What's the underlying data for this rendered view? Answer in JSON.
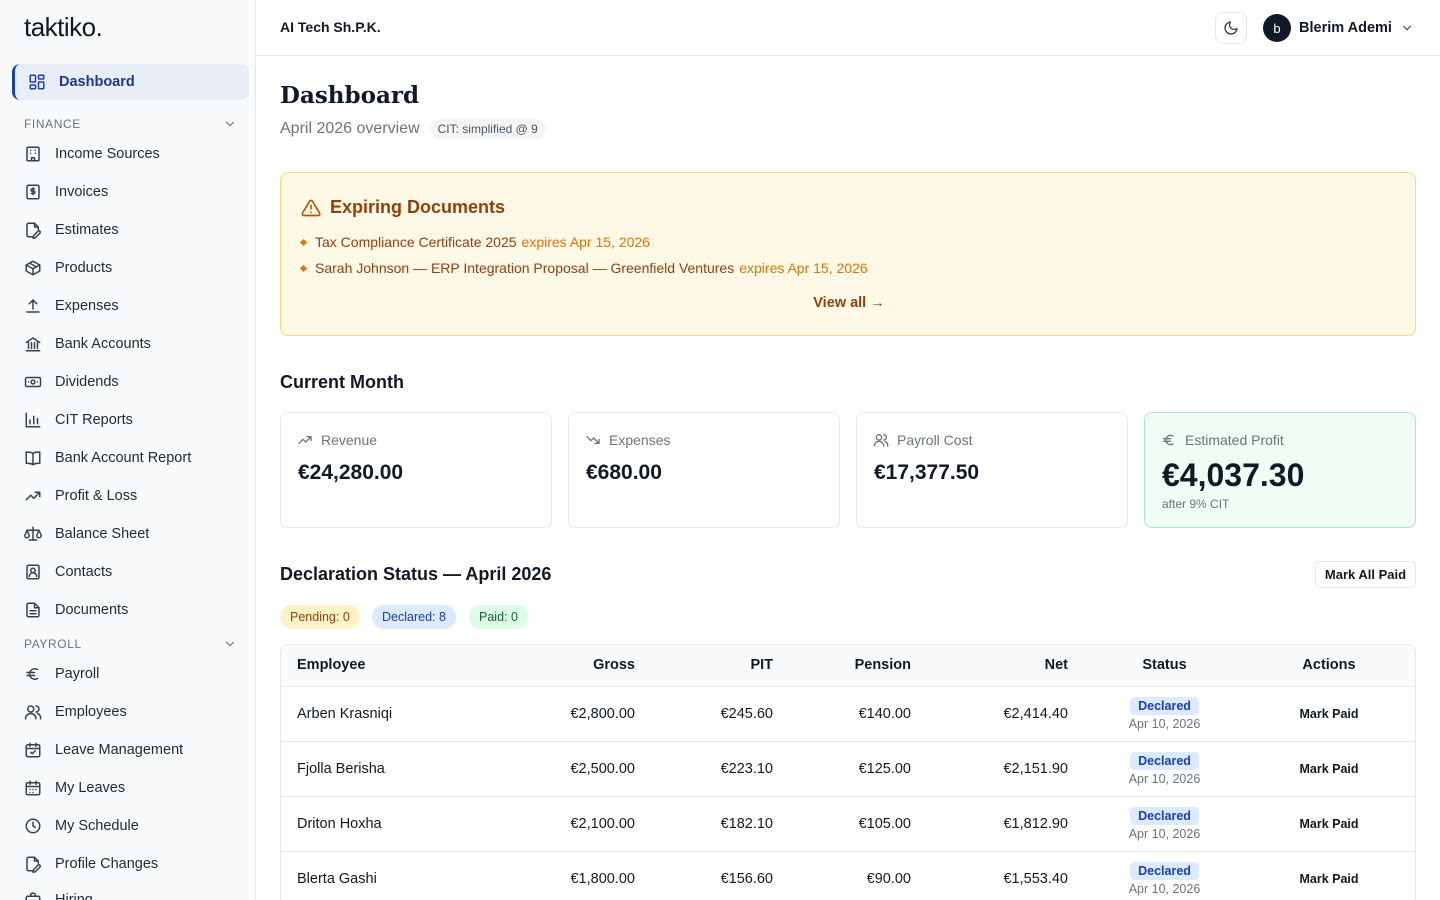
{
  "brand": {
    "logo": "taktiko."
  },
  "header": {
    "company": "AI Tech Sh.P.K.",
    "user": {
      "initial": "b",
      "name": "Blerim Ademi"
    }
  },
  "sidebar": {
    "active": {
      "label": "Dashboard",
      "icon": "dashboard-icon"
    },
    "finance_section": "FINANCE",
    "finance_items": [
      {
        "label": "Income Sources",
        "icon": "building-icon"
      },
      {
        "label": "Invoices",
        "icon": "invoice-icon"
      },
      {
        "label": "Estimates",
        "icon": "file-edit-icon"
      },
      {
        "label": "Products",
        "icon": "package-icon"
      },
      {
        "label": "Expenses",
        "icon": "upload-icon"
      },
      {
        "label": "Bank Accounts",
        "icon": "bank-icon"
      },
      {
        "label": "Dividends",
        "icon": "banknote-icon"
      },
      {
        "label": "CIT Reports",
        "icon": "bar-chart-icon"
      },
      {
        "label": "Bank Account Report",
        "icon": "book-icon"
      },
      {
        "label": "Profit & Loss",
        "icon": "trending-up-icon"
      },
      {
        "label": "Balance Sheet",
        "icon": "scale-icon"
      },
      {
        "label": "Contacts",
        "icon": "contact-icon"
      },
      {
        "label": "Documents",
        "icon": "document-icon"
      }
    ],
    "payroll_section": "PAYROLL",
    "payroll_items": [
      {
        "label": "Payroll",
        "icon": "euro-icon"
      },
      {
        "label": "Employees",
        "icon": "users-icon"
      },
      {
        "label": "Leave Management",
        "icon": "calendar-check-icon"
      },
      {
        "label": "My Leaves",
        "icon": "calendar-icon"
      },
      {
        "label": "My Schedule",
        "icon": "clock-icon"
      },
      {
        "label": "Profile Changes",
        "icon": "file-edit-icon"
      },
      {
        "label": "Hiring",
        "icon": "briefcase-icon"
      }
    ]
  },
  "page": {
    "title": "Dashboard",
    "subtitle": "April 2026 overview",
    "cit_badge": "CIT: simplified @ 9"
  },
  "alert": {
    "title": "Expiring Documents",
    "items": [
      {
        "name": "Tax Compliance Certificate 2025",
        "expires": "expires Apr 15, 2026"
      },
      {
        "name": "Sarah Johnson — ERP Integration Proposal — Greenfield Ventures",
        "expires": "expires Apr 15, 2026"
      }
    ],
    "view_all": "View all →"
  },
  "current_month": {
    "title": "Current Month",
    "cards": [
      {
        "label": "Revenue",
        "value": "€24,280.00",
        "icon": "trending-up-icon"
      },
      {
        "label": "Expenses",
        "value": "€680.00",
        "icon": "trending-down-icon"
      },
      {
        "label": "Payroll Cost",
        "value": "€17,377.50",
        "icon": "users-icon"
      },
      {
        "label": "Estimated Profit",
        "value": "€4,037.30",
        "note": "after 9% CIT",
        "icon": "euro-icon"
      }
    ]
  },
  "declaration": {
    "title": "Declaration Status — April 2026",
    "mark_all_label": "Mark All Paid",
    "counts": {
      "pending": "Pending: 0",
      "declared": "Declared: 8",
      "paid": "Paid: 0"
    },
    "columns": [
      "Employee",
      "Gross",
      "PIT",
      "Pension",
      "Net",
      "Status",
      "Actions"
    ],
    "rows": [
      {
        "employee": "Arben Krasniqi",
        "gross": "€2,800.00",
        "pit": "€245.60",
        "pension": "€140.00",
        "net": "€2,414.40",
        "status": "Declared",
        "date": "Apr 10, 2026",
        "action": "Mark Paid"
      },
      {
        "employee": "Fjolla Berisha",
        "gross": "€2,500.00",
        "pit": "€223.10",
        "pension": "€125.00",
        "net": "€2,151.90",
        "status": "Declared",
        "date": "Apr 10, 2026",
        "action": "Mark Paid"
      },
      {
        "employee": "Driton Hoxha",
        "gross": "€2,100.00",
        "pit": "€182.10",
        "pension": "€105.00",
        "net": "€1,812.90",
        "status": "Declared",
        "date": "Apr 10, 2026",
        "action": "Mark Paid"
      },
      {
        "employee": "Blerta Gashi",
        "gross": "€1,800.00",
        "pit": "€156.60",
        "pension": "€90.00",
        "net": "€1,553.40",
        "status": "Declared",
        "date": "Apr 10, 2026",
        "action": "Mark Paid"
      }
    ]
  }
}
